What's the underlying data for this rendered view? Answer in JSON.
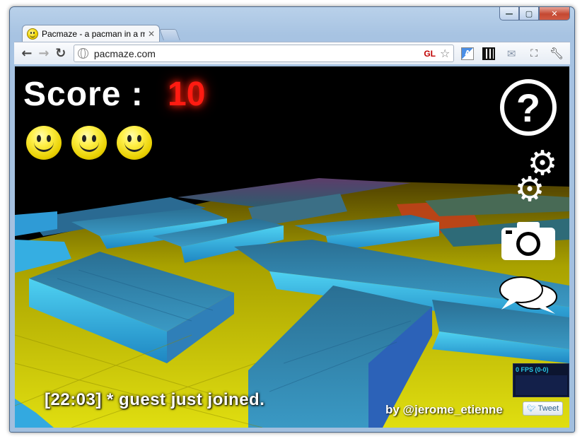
{
  "browser": {
    "tab_title": "Pacmaze - a pacman in a m",
    "tab_close": "✕",
    "url": "pacmaze.com",
    "gl_badge": "GL",
    "controls": {
      "minimize": "—",
      "maximize": "▢",
      "close": "✕"
    }
  },
  "game": {
    "score_label": "Score :",
    "score_value": "10",
    "lives": 3,
    "help_glyph": "?",
    "stats_text": "0 FPS (0-0)",
    "chat_message": "[22:03] * guest just joined.",
    "credit": "by @jerome_etienne",
    "tweet_label": "Tweet"
  },
  "colors": {
    "score_value": "#ff1b12",
    "floor": "#c9c400",
    "wall": "#3aa6d8"
  },
  "icons": [
    "back-icon",
    "forward-icon",
    "reload-icon",
    "globe-icon",
    "star-icon",
    "translate-icon",
    "qr-icon",
    "mail-icon",
    "fullscreen-icon",
    "wrench-icon",
    "help-icon",
    "settings-icon",
    "camera-icon",
    "chat-icon",
    "twitter-bird-icon"
  ]
}
